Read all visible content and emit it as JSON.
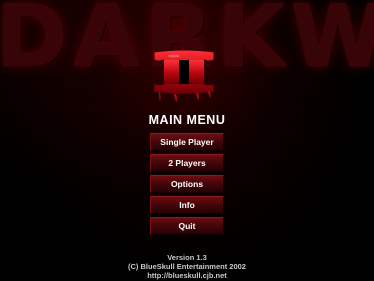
{
  "game": {
    "title": "DARKWAR",
    "numeral": "II"
  },
  "menu": {
    "title": "MAIN MENU",
    "items": [
      {
        "label": "Single Player"
      },
      {
        "label": "2 Players"
      },
      {
        "label": "Options"
      },
      {
        "label": "Info"
      },
      {
        "label": "Quit"
      }
    ]
  },
  "footer": {
    "version": "Version 1.3",
    "copyright": "(C) BlueSkull Entertainment 2002",
    "url": "http://blueskull.cjb.net"
  },
  "colors": {
    "background": "#000000",
    "button": "#4a070b",
    "logo": "#3a0508",
    "numeral": "#d01018",
    "text": "#ffffff"
  }
}
